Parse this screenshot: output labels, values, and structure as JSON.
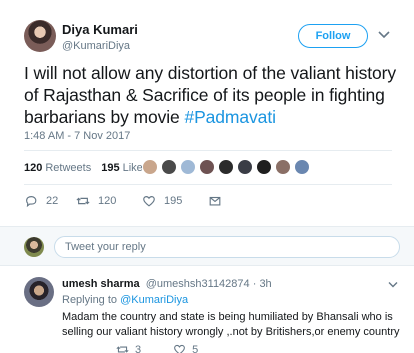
{
  "tweet": {
    "author_name": "Diya Kumari",
    "author_handle": "@KumariDiya",
    "follow_label": "Follow",
    "text_main": "I will not allow any distortion of the valiant history of Rajasthan & Sacrifice of its people in fighting barbarians by movie ",
    "hashtag": "#Padmavati",
    "timestamp": "1:48 AM - 7 Nov 2017",
    "retweets_count": "120",
    "retweets_label": "Retweets",
    "likes_count": "195",
    "likes_label": "Likes",
    "liker_colors": [
      "#c9a68c",
      "#4a4a4a",
      "#9fb9d6",
      "#6e5252",
      "#2b2b2b",
      "#3a3d46",
      "#1f1f1f",
      "#8a6f66",
      "#6a87b0"
    ],
    "actions": {
      "reply_count": "22",
      "retweet_count": "120",
      "like_count": "195"
    }
  },
  "reply_box": {
    "placeholder": "Tweet your reply"
  },
  "reply": {
    "name": "umesh sharma",
    "handle": "@umeshsh31142874",
    "time": "· 3h",
    "replying_prefix": "Replying to ",
    "replying_to": "@KumariDiya",
    "text": "Madam the country and state is being humiliated by Bhansali who is selling our valiant history wrongly ,.not by Britishers,or enemy country",
    "retweet_count": "3",
    "like_count": "5"
  },
  "colors": {
    "accent": "#1da1f2",
    "link": "#1b95e0",
    "muted": "#657786",
    "divider": "#e6ecf0"
  }
}
